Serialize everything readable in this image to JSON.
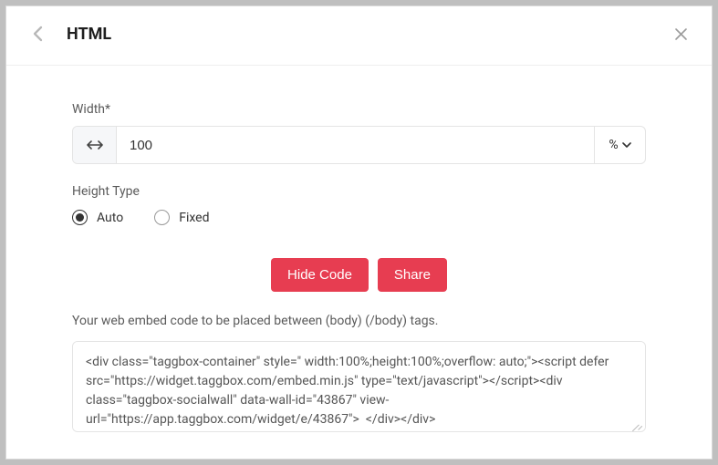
{
  "header": {
    "title": "HTML"
  },
  "form": {
    "width_label": "Width*",
    "width_value": "100",
    "unit_label": "%",
    "height_type_label": "Height Type",
    "radio_auto": "Auto",
    "radio_fixed": "Fixed",
    "selected_height_type": "Auto"
  },
  "buttons": {
    "hide_code": "Hide Code",
    "share": "Share"
  },
  "embed": {
    "hint": "Your web embed code to be placed between (body) (/body) tags.",
    "code": "<div class=\"taggbox-container\" style=\" width:100%;height:100%;overflow: auto;\"><script defer src=\"https://widget.taggbox.com/embed.min.js\" type=\"text/javascript\"></script><div class=\"taggbox-socialwall\" data-wall-id=\"43867\" view-url=\"https://app.taggbox.com/widget/e/43867\">  </div></div>"
  }
}
